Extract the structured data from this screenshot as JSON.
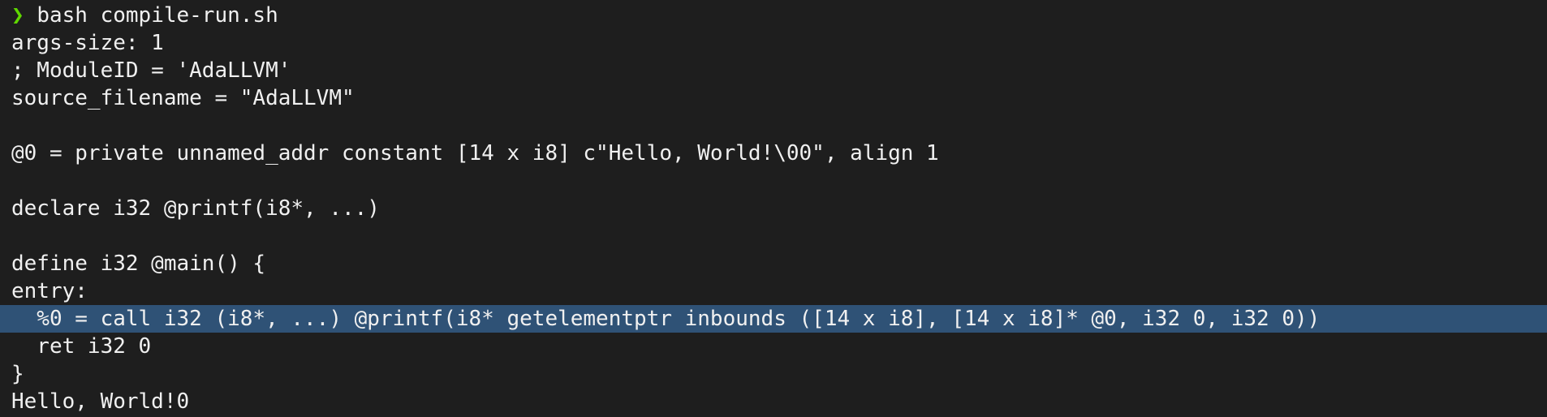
{
  "terminal": {
    "prompt": {
      "symbol": "❯",
      "command": "bash compile-run.sh"
    },
    "lines": [
      "args-size: 1",
      "; ModuleID = 'AdaLLVM'",
      "source_filename = \"AdaLLVM\"",
      "",
      "@0 = private unnamed_addr constant [14 x i8] c\"Hello, World!\\00\", align 1",
      "",
      "declare i32 @printf(i8*, ...)",
      "",
      "define i32 @main() {",
      "entry:",
      "  %0 = call i32 (i8*, ...) @printf(i8* getelementptr inbounds ([14 x i8], [14 x i8]* @0, i32 0, i32 0))",
      "  ret i32 0",
      "}",
      "Hello, World!0"
    ],
    "highlighted_line_index": 10,
    "colors": {
      "background": "#1e1e1e",
      "text": "#f0f0f0",
      "prompt_symbol": "#5fd700",
      "selection": "#2f5276"
    }
  }
}
